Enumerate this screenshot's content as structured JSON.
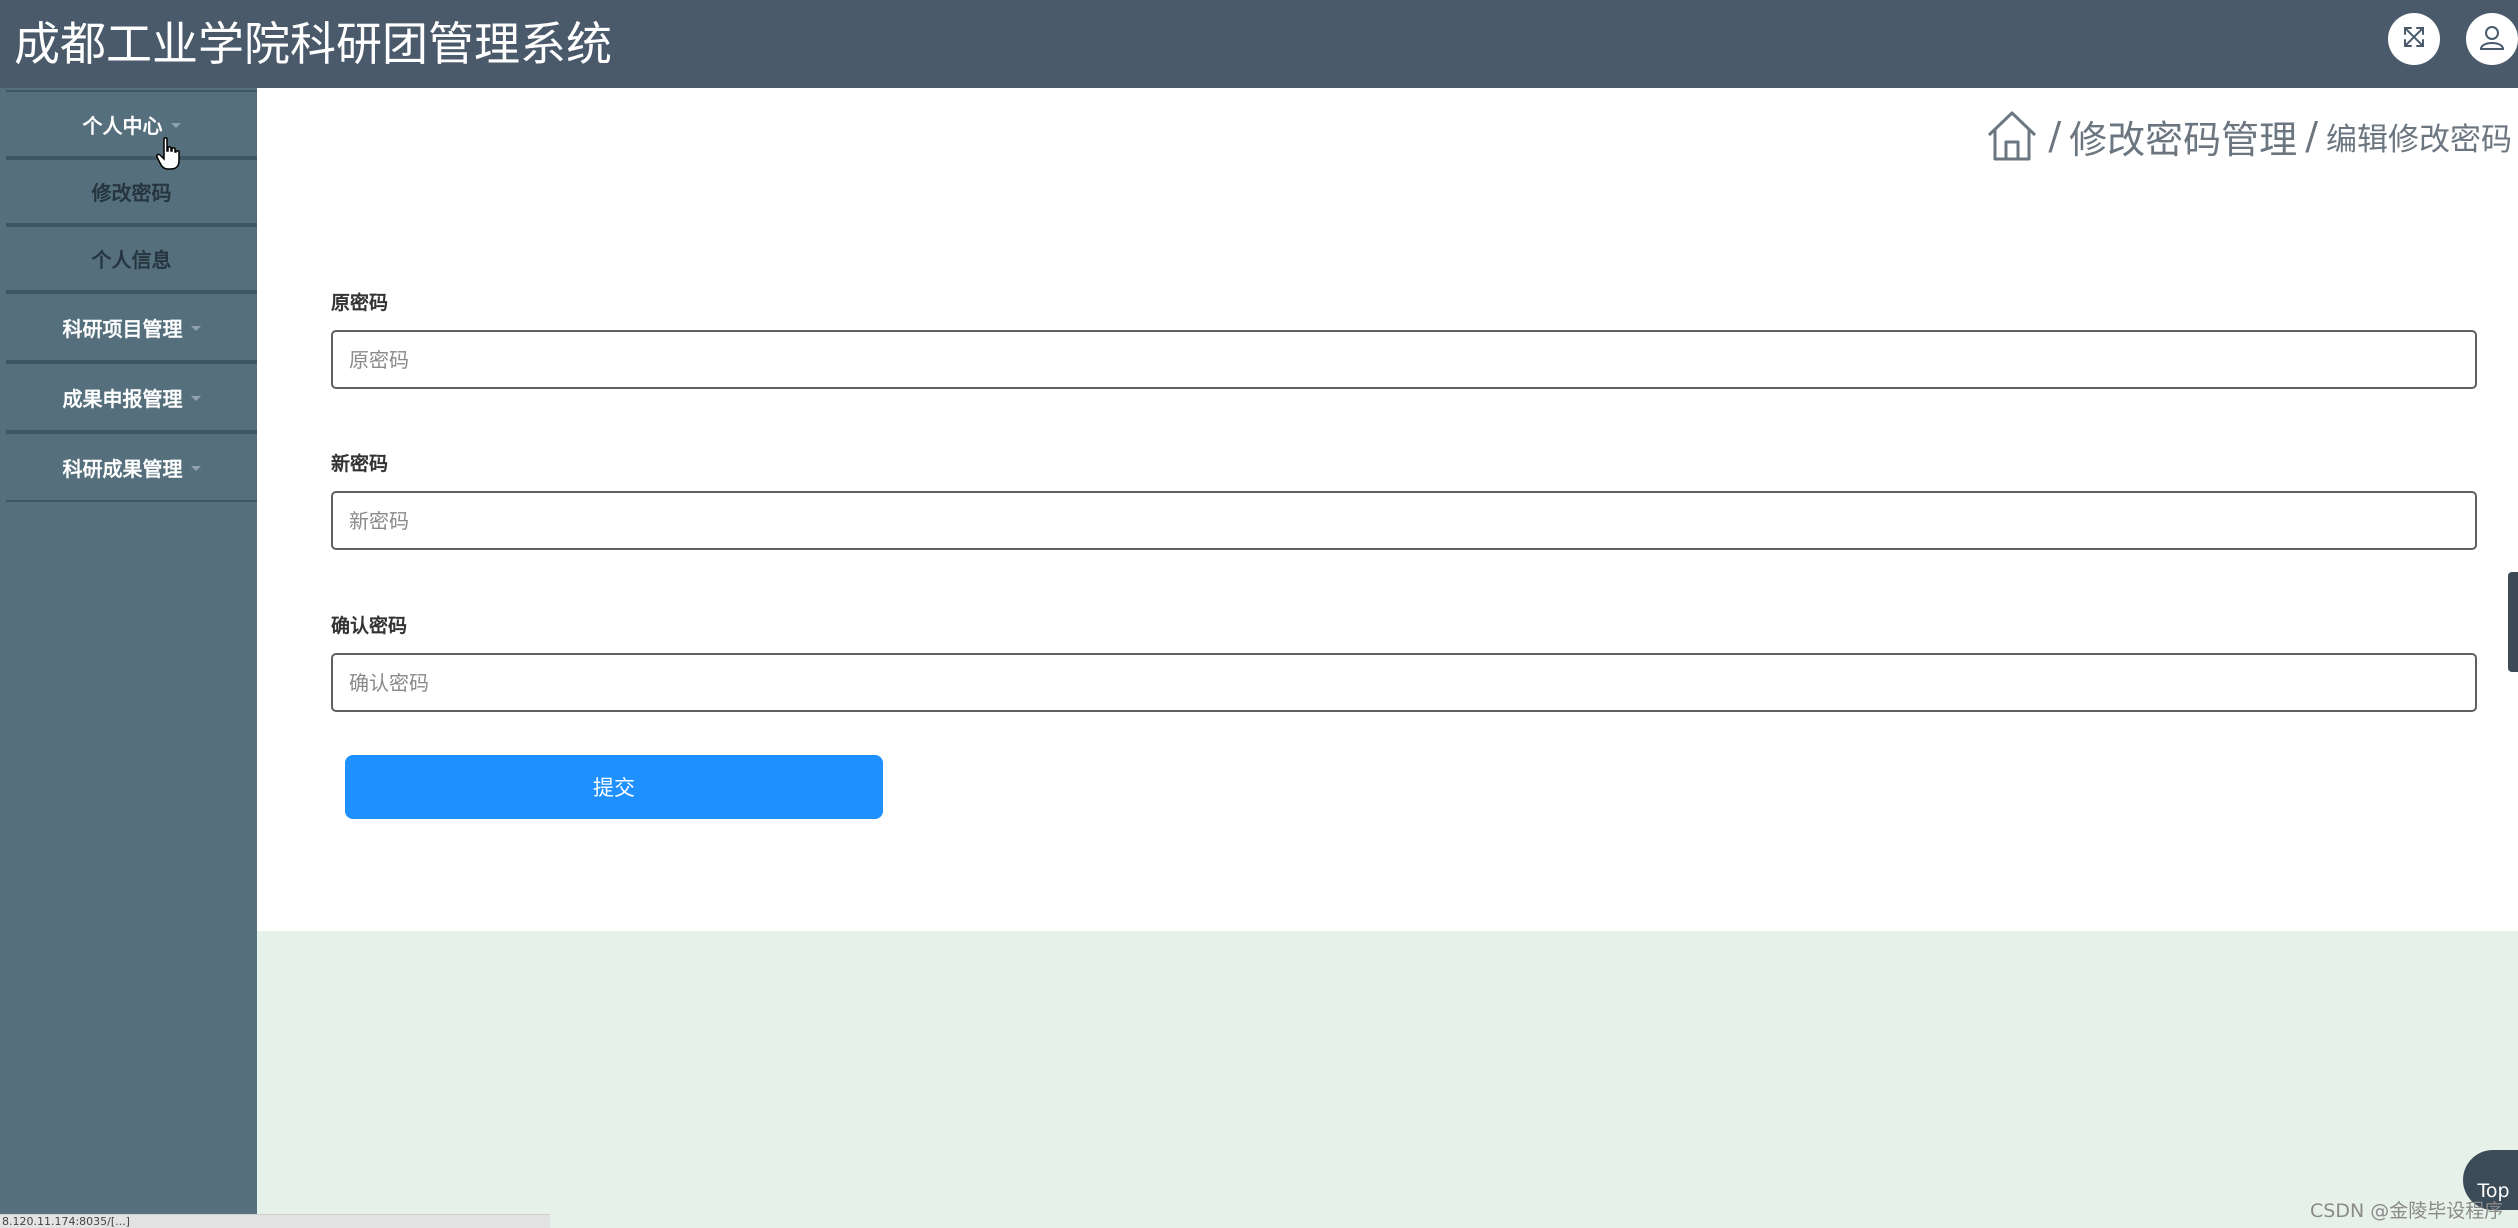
{
  "header": {
    "title": "成都工业学院科研团管理系统",
    "icons": {
      "fullscreen": "fullscreen-toggle-icon",
      "user": "user-icon"
    }
  },
  "sidebar": {
    "items": [
      {
        "label": "个人中心",
        "type": "group",
        "expanded": true
      },
      {
        "label": "修改密码",
        "type": "sub"
      },
      {
        "label": "个人信息",
        "type": "sub"
      },
      {
        "label": "科研项目管理",
        "type": "group"
      },
      {
        "label": "成果申报管理",
        "type": "group"
      },
      {
        "label": "科研成果管理",
        "type": "group"
      }
    ]
  },
  "breadcrumb": {
    "separator": "/",
    "link": "修改密码管理",
    "current": "编辑修改密码"
  },
  "form": {
    "fields": [
      {
        "label": "原密码",
        "placeholder": "原密码",
        "value": ""
      },
      {
        "label": "新密码",
        "placeholder": "新密码",
        "value": ""
      },
      {
        "label": "确认密码",
        "placeholder": "确认密码",
        "value": ""
      }
    ],
    "submit_label": "提交"
  },
  "floating": {
    "top_label": "Top"
  },
  "watermark": "CSDN @金陵毕设程序",
  "status_bar": {
    "url": "8.120.11.174:8035/[...]"
  },
  "colors": {
    "header_bg": "#4a5a6b",
    "sidebar_bg": "#57707e",
    "accent": "#1e90ff",
    "page_bg": "#e6f1ea"
  }
}
